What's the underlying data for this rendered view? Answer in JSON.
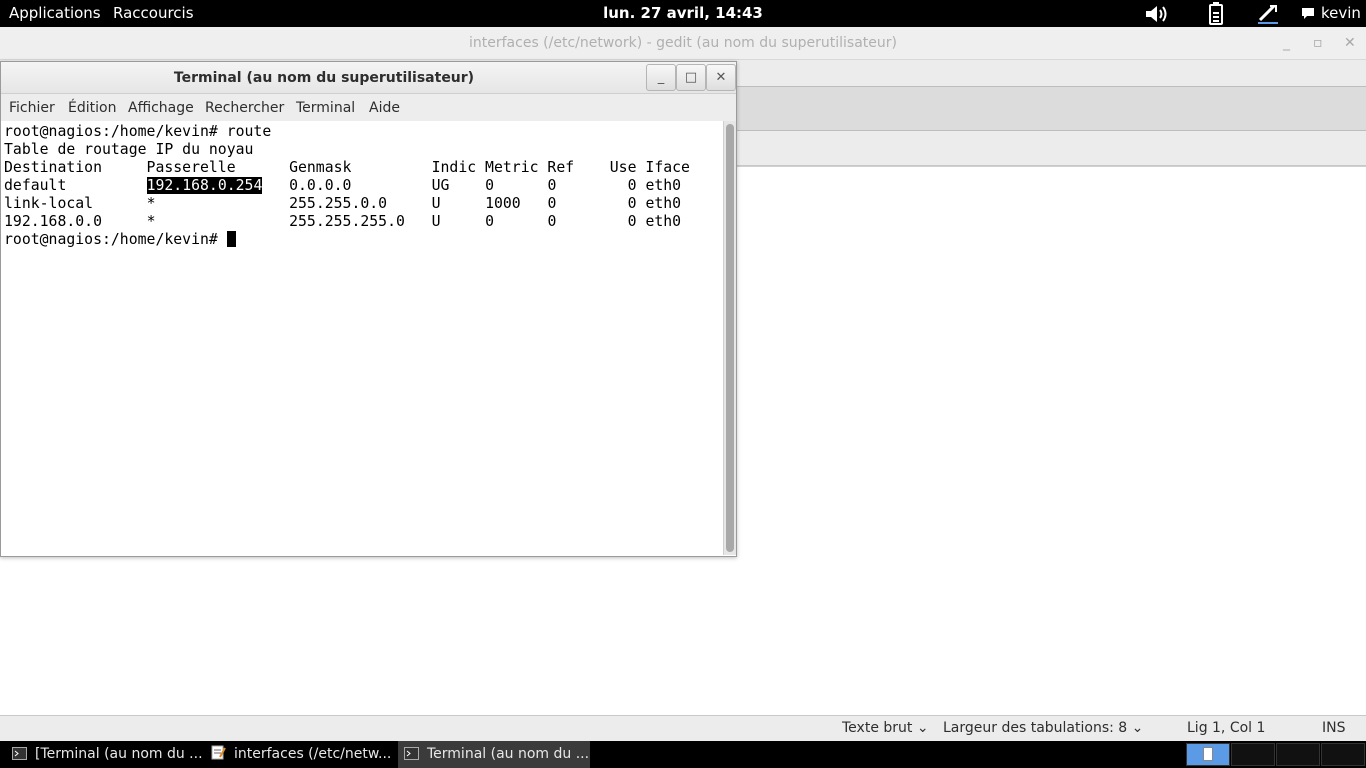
{
  "top_panel": {
    "applications": "Applications",
    "shortcuts": "Raccourcis",
    "clock": "lun. 27 avril, 14:43",
    "user": "kevin",
    "tray_icons": [
      "volume-icon",
      "battery-icon",
      "network-icon",
      "chat-icon"
    ]
  },
  "gedit": {
    "title": "interfaces (/etc/network) - gedit (au nom du superutilisateur)",
    "status": {
      "syntax": "Texte brut",
      "tab_width_label": "Largeur des tabulations:",
      "tab_width_value": "8",
      "position": "Lig 1, Col 1",
      "mode": "INS"
    }
  },
  "terminal": {
    "title": "Terminal (au nom du superutilisateur)",
    "menu": [
      "Fichier",
      "Édition",
      "Affichage",
      "Rechercher",
      "Terminal",
      "Aide"
    ],
    "lines": [
      "root@nagios:/home/kevin# route",
      "Table de routage IP du noyau",
      "Destination     Passerelle      Genmask         Indic Metric Ref    Use Iface"
    ],
    "route_rows": [
      {
        "dest": "default        ",
        "gw": "192.168.0.254",
        "rest": "   0.0.0.0         UG    0      0        0 eth0"
      },
      {
        "dest": "link-local     ",
        "gw": "*            ",
        "rest": "   255.255.0.0     U     1000   0        0 eth0"
      },
      {
        "dest": "192.168.0.0    ",
        "gw": "*            ",
        "rest": "   255.255.255.0   U     0      0        0 eth0"
      }
    ],
    "prompt": "root@nagios:/home/kevin# "
  },
  "taskbar": {
    "items": [
      {
        "label": "[Terminal (au nom du ...",
        "icon": "terminal-icon"
      },
      {
        "label": "interfaces (/etc/netw...",
        "icon": "text-editor-icon"
      },
      {
        "label": "Terminal (au nom du ...",
        "icon": "terminal-icon"
      }
    ]
  },
  "colors": {
    "panel": "#000000",
    "selection": "#000000",
    "active_task": "#3b3b3b",
    "workspace_active": "#5b9be6"
  }
}
